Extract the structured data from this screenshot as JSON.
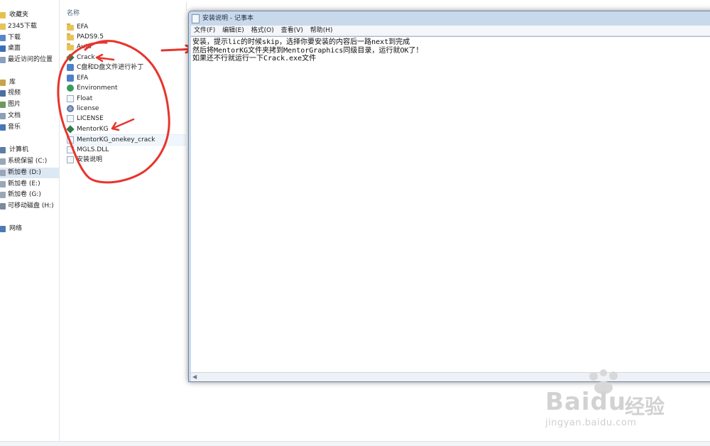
{
  "explorer": {
    "nav": {
      "favorites_label": "收藏夹",
      "favorites": [
        "2345下载",
        "下载",
        "桌面",
        "最近访问的位置"
      ],
      "library_label": "库",
      "libraries": [
        "视频",
        "图片",
        "文档",
        "音乐"
      ],
      "computer_label": "计算机",
      "drives": [
        "系统保留 (C:)",
        "新加卷 (D:)",
        "新加卷 (E:)",
        "新加卷 (G:)",
        "可移动磁盘 (H:)"
      ],
      "selected_drive": "新加卷 (D:)",
      "network_label": "网络"
    },
    "column_header": "名称",
    "files": [
      {
        "name": "EFA",
        "icon": "folder-icon"
      },
      {
        "name": "PADS9.5",
        "icon": "folder-icon"
      },
      {
        "name": "Auto",
        "icon": "folder-icon"
      },
      {
        "name": "Crack",
        "icon": "exe-icon"
      },
      {
        "name": "C盘和D盘文件进行补丁",
        "icon": "script-icon"
      },
      {
        "name": "EFA",
        "icon": "app-icon"
      },
      {
        "name": "Environment",
        "icon": "app-icon"
      },
      {
        "name": "Float",
        "icon": "document-icon"
      },
      {
        "name": "license",
        "icon": "settings-icon"
      },
      {
        "name": "LICENSE",
        "icon": "document-icon"
      },
      {
        "name": "MentorKG",
        "icon": "exe-icon"
      },
      {
        "name": "MentorKG_onekey_crack",
        "icon": "document-icon"
      },
      {
        "name": "MGLS.DLL",
        "icon": "document-icon"
      },
      {
        "name": "安装说明",
        "icon": "document-icon"
      }
    ]
  },
  "notepad": {
    "title": "安装说明 - 记事本",
    "menu": [
      "文件(F)",
      "编辑(E)",
      "格式(O)",
      "查看(V)",
      "帮助(H)"
    ],
    "lines": [
      "安装，提示lic的时候skip，选择你要安装的内容后一路next到完成",
      "然后将MentorKG文件夹拷到MentorGraphics同级目录，运行就OK了！",
      "如果还不行就运行一下Crack.exe文件"
    ]
  },
  "watermark": {
    "brand": "Bai",
    "brand_end": "du",
    "cn": "经验",
    "url": "jingyan.baidu.com"
  },
  "colors": {
    "annotation": "#e8342c",
    "window_frame": "#c9d9ec",
    "selection": "#dde8f5"
  }
}
